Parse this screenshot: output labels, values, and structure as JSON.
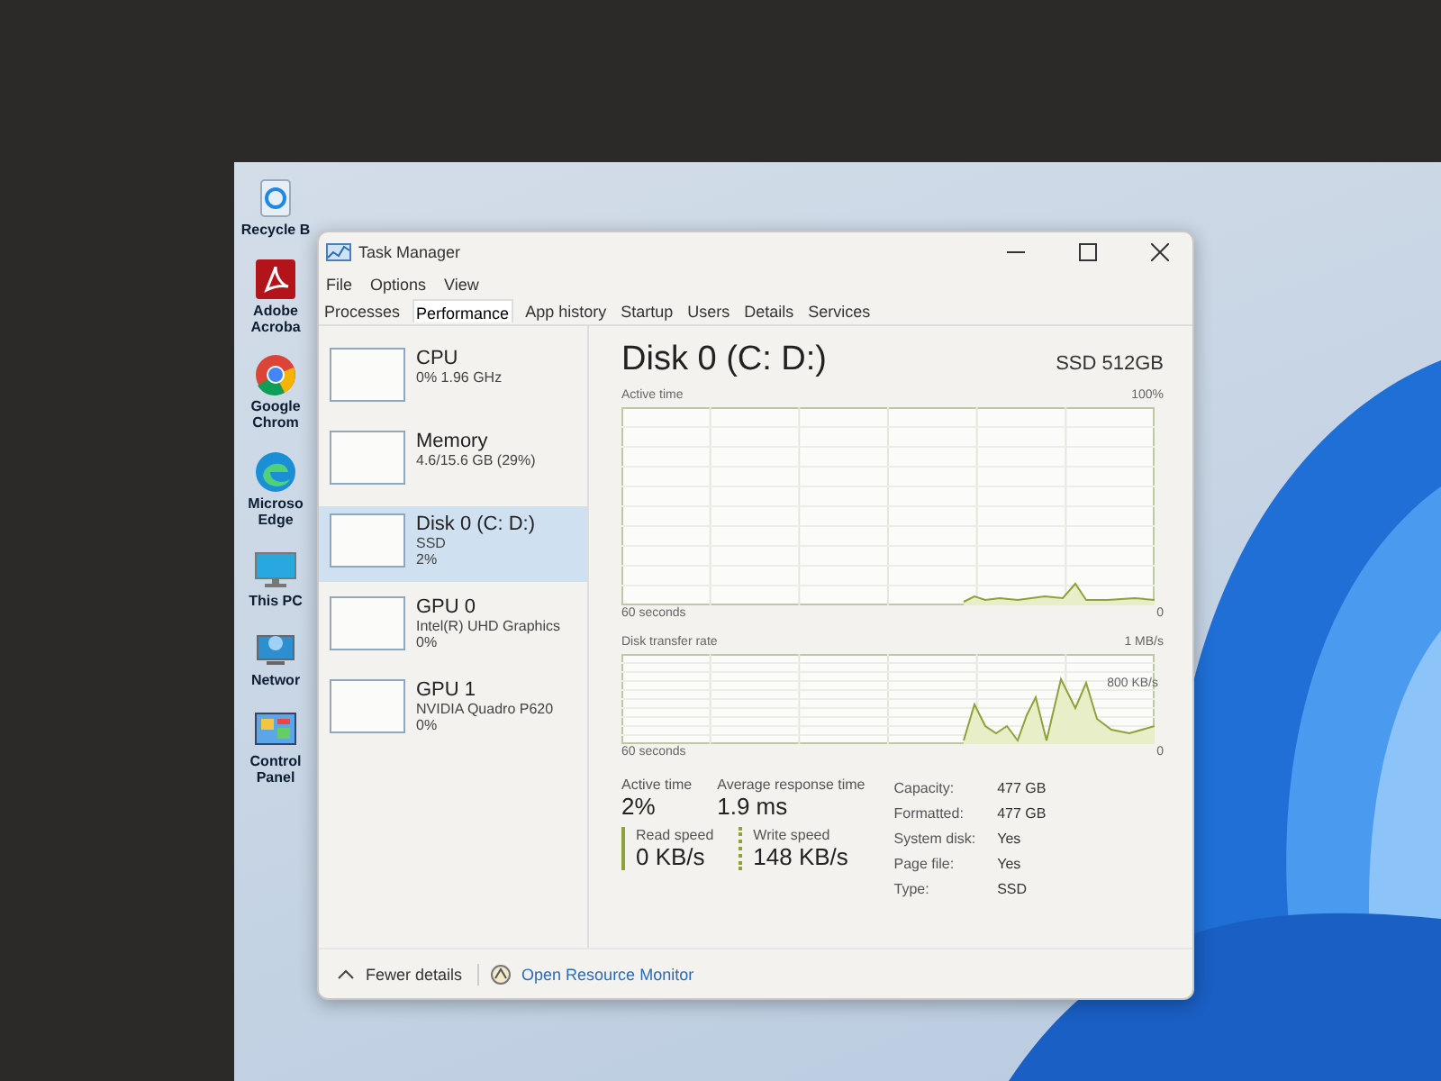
{
  "desktop": {
    "icons": [
      {
        "kind": "recycle",
        "label": "Recycle B"
      },
      {
        "kind": "pdf",
        "label": "Adobe Acroba"
      },
      {
        "kind": "chrome",
        "label": "Google Chrom"
      },
      {
        "kind": "edge",
        "label": "Microso Edge"
      },
      {
        "kind": "monitor",
        "label": "This PC"
      },
      {
        "kind": "network",
        "label": "Networ"
      },
      {
        "kind": "control",
        "label": "Control Panel"
      }
    ]
  },
  "window": {
    "title": "Task Manager",
    "menu": [
      "File",
      "Options",
      "View"
    ],
    "tabs": [
      {
        "label": "Processes",
        "selected": false
      },
      {
        "label": "Performance",
        "selected": true
      },
      {
        "label": "App history",
        "selected": false
      },
      {
        "label": "Startup",
        "selected": false
      },
      {
        "label": "Users",
        "selected": false
      },
      {
        "label": "Details",
        "selected": false
      },
      {
        "label": "Services",
        "selected": false
      }
    ],
    "sidebar": {
      "items": [
        {
          "name": "CPU",
          "lines": [
            "0% 1.96 GHz"
          ],
          "selected": false
        },
        {
          "name": "Memory",
          "lines": [
            "4.6/15.6 GB (29%)"
          ],
          "selected": false
        },
        {
          "name": "Disk 0 (C: D:)",
          "lines": [
            "SSD",
            "2%"
          ],
          "selected": true
        },
        {
          "name": "GPU 0",
          "lines": [
            "Intel(R) UHD Graphics",
            "0%"
          ],
          "selected": false
        },
        {
          "name": "GPU 1",
          "lines": [
            "NVIDIA Quadro P620",
            "0%"
          ],
          "selected": false
        }
      ]
    },
    "detail": {
      "title": "Disk 0 (C: D:)",
      "model": "SSD 512GB",
      "graphs": [
        {
          "kind": "active",
          "label": "Active time",
          "max": "100%",
          "span": "60 seconds",
          "min": "0"
        },
        {
          "kind": "transfer",
          "label": "Disk transfer rate",
          "max": "1 MB/s",
          "inner": "800 KB/s",
          "span": "60 seconds",
          "min": "0"
        }
      ],
      "stats": [
        {
          "label": "Active time",
          "value": "2%"
        },
        {
          "label": "Average response time",
          "value": "1.9 ms"
        }
      ],
      "speeds": [
        {
          "kind": "read",
          "label": "Read speed",
          "value": "0 KB/s"
        },
        {
          "kind": "write",
          "label": "Write speed",
          "value": "148 KB/s"
        }
      ],
      "properties": [
        {
          "label": "Capacity:",
          "value": "477 GB"
        },
        {
          "label": "Formatted:",
          "value": "477 GB"
        },
        {
          "label": "System disk:",
          "value": "Yes"
        },
        {
          "label": "Page file:",
          "value": "Yes"
        },
        {
          "label": "Type:",
          "value": "SSD"
        }
      ]
    },
    "footer": {
      "toggle": "Fewer details",
      "link": "Open Resource Monitor"
    }
  }
}
